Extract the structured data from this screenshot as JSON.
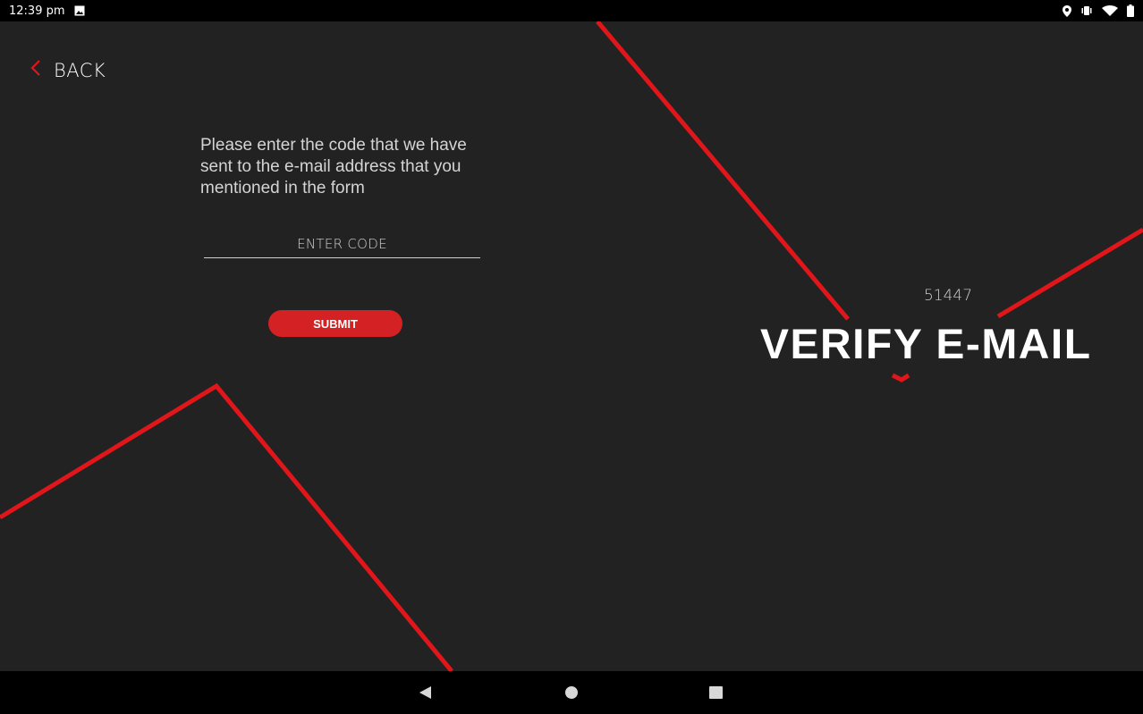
{
  "status_bar": {
    "time": "12:39 pm",
    "icons": [
      "image-icon",
      "location-icon",
      "vibrate-icon",
      "wifi-icon",
      "battery-icon"
    ]
  },
  "header": {
    "back_label": "BACK"
  },
  "form": {
    "instruction": "Please enter the code that we have sent to the e-mail address that you mentioned in the form",
    "code_placeholder": "ENTER CODE",
    "code_value": "",
    "submit_label": "SUBMIT"
  },
  "side": {
    "code_display": "51447",
    "title": "VERIFY E-MAIL"
  },
  "colors": {
    "background": "#222222",
    "accent": "#d42224",
    "line": "#e0161a"
  }
}
